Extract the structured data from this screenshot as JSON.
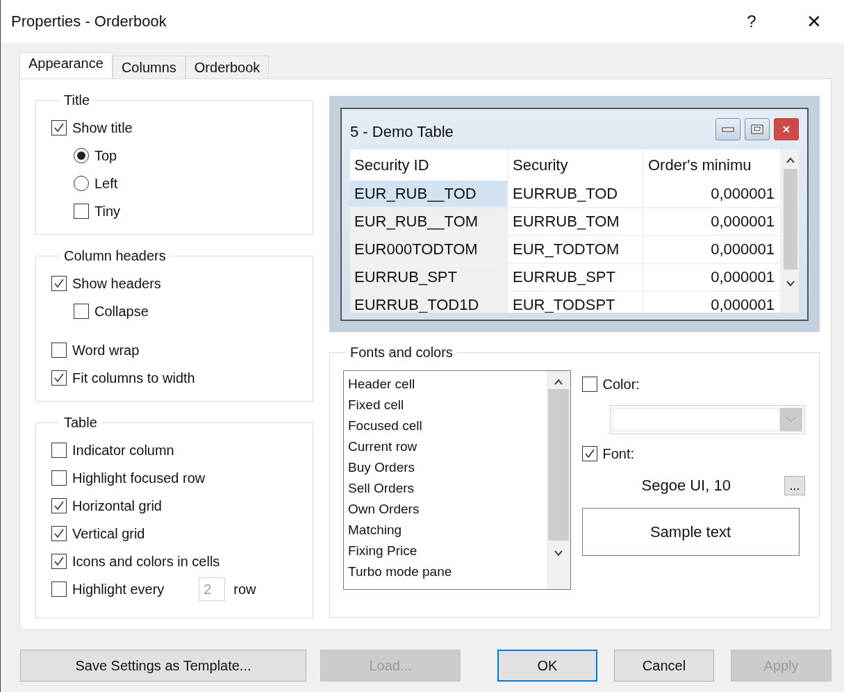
{
  "window": {
    "title": "Properties - Orderbook",
    "help": "?",
    "close": "✕"
  },
  "tabs": [
    {
      "label": "Appearance",
      "selected": true
    },
    {
      "label": "Columns",
      "selected": false
    },
    {
      "label": "Orderbook",
      "selected": false
    }
  ],
  "groups": [
    {
      "label": "Title",
      "items": [
        {
          "kind": "checkbox",
          "label": "Show title",
          "checked": true,
          "children": [
            {
              "kind": "radio",
              "label": "Top",
              "selected": true
            },
            {
              "kind": "radio",
              "label": "Left",
              "selected": false
            },
            {
              "kind": "checkbox",
              "label": "Tiny",
              "checked": false
            }
          ]
        }
      ]
    },
    {
      "label": "Column headers",
      "items": [
        {
          "kind": "checkbox",
          "label": "Show headers",
          "checked": true,
          "children": [
            {
              "kind": "checkbox",
              "label": "Collapse",
              "checked": false
            }
          ]
        },
        {
          "kind": "checkbox",
          "label": "Word wrap",
          "checked": false
        },
        {
          "kind": "checkbox",
          "label": "Fit columns to width",
          "checked": true
        }
      ]
    },
    {
      "label": "Table",
      "items": [
        {
          "kind": "checkbox",
          "label": "Indicator column",
          "checked": false
        },
        {
          "kind": "checkbox",
          "label": "Highlight focused row",
          "checked": false
        },
        {
          "kind": "checkbox",
          "label": "Horizontal grid",
          "checked": true
        },
        {
          "kind": "checkbox",
          "label": "Vertical grid",
          "checked": true
        },
        {
          "kind": "checkbox",
          "label": "Icons and colors in cells",
          "checked": true
        },
        {
          "kind": "checkbox_number",
          "label": "Highlight every",
          "checked": false,
          "value": "2",
          "disabled": true,
          "suffix": "row"
        }
      ]
    }
  ],
  "preview": {
    "title": "5 - Demo Table",
    "columns": [
      "Security ID",
      "Security",
      "Order's minimu"
    ],
    "rows": [
      {
        "cells": [
          "EUR_RUB__TOD",
          "EURRUB_TOD",
          "0,000001"
        ],
        "selected": true
      },
      {
        "cells": [
          "EUR_RUB__TOM",
          "EURRUB_TOM",
          "0,000001"
        ],
        "selected": false
      },
      {
        "cells": [
          "EUR000TODTOM",
          "EUR_TODTOM",
          "0,000001"
        ],
        "selected": false
      },
      {
        "cells": [
          "EURRUB_SPT",
          "EURRUB_SPT",
          "0,000001"
        ],
        "selected": false
      },
      {
        "cells": [
          "EURRUB_TOD1D",
          "EUR_TODSPT",
          "0,000001"
        ],
        "selected": false
      }
    ]
  },
  "fonts_and_colors": {
    "label": "Fonts and colors",
    "elements": [
      {
        "label": "Header cell",
        "selected": false
      },
      {
        "label": "Fixed cell",
        "selected": false
      },
      {
        "label": "Focused cell",
        "selected": false
      },
      {
        "label": "Current row",
        "selected": false
      },
      {
        "label": "Buy Orders",
        "selected": false
      },
      {
        "label": "Sell Orders",
        "selected": false
      },
      {
        "label": "Own Orders",
        "selected": false
      },
      {
        "label": "Matching",
        "selected": false
      },
      {
        "label": "Fixing Price",
        "selected": false
      },
      {
        "label": "Turbo mode pane",
        "selected": false
      }
    ],
    "color": {
      "label": "Color:",
      "checked": false,
      "disabled": true
    },
    "font": {
      "label": "Font:",
      "checked": true,
      "value": "Segoe UI, 10",
      "browse": "..."
    },
    "sample": "Sample text"
  },
  "buttons": [
    {
      "label": "Save Settings as Template...",
      "disabled": false,
      "default": false
    },
    {
      "label": "Load...",
      "disabled": true,
      "default": false
    },
    {
      "label": "OK",
      "disabled": false,
      "default": true
    },
    {
      "label": "Cancel",
      "disabled": false,
      "default": false
    },
    {
      "label": "Apply",
      "disabled": true,
      "default": false
    }
  ]
}
